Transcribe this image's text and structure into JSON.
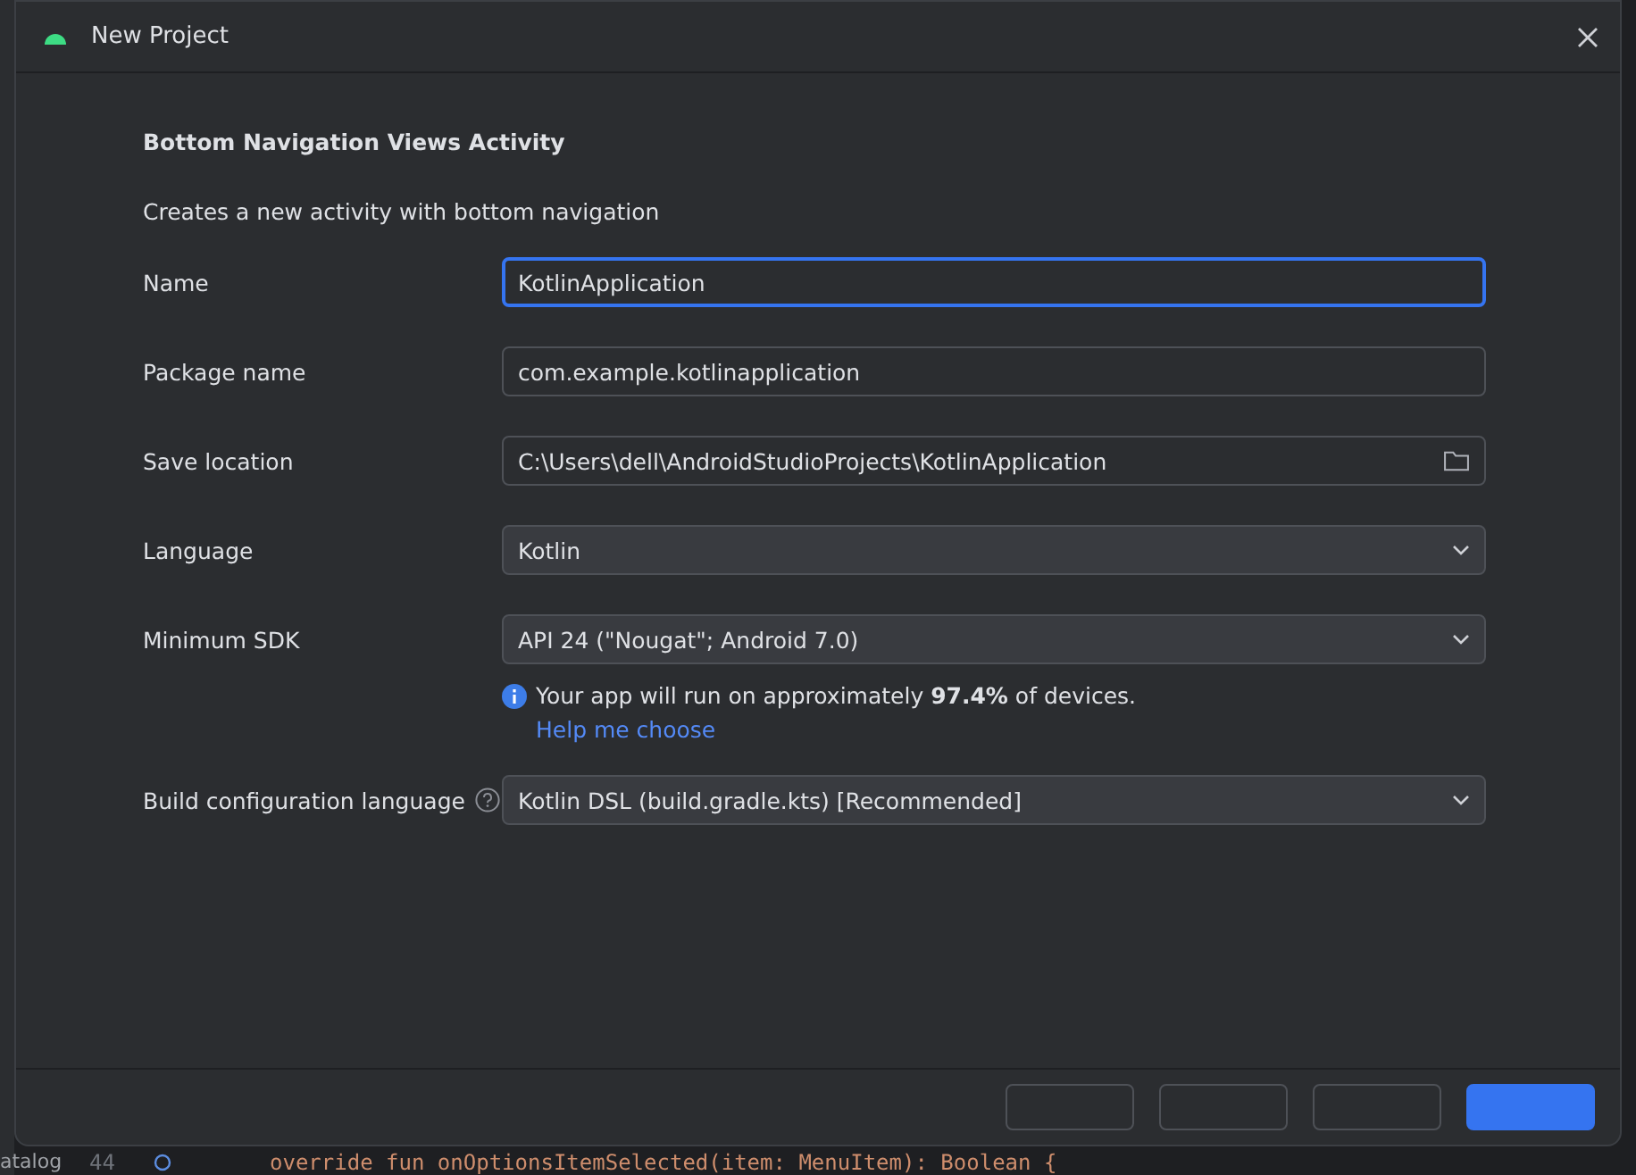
{
  "window": {
    "title": "New Project"
  },
  "heading": "Bottom Navigation Views Activity",
  "description": "Creates a new activity with bottom navigation",
  "fields": [
    {
      "label": "Name",
      "kind": "text",
      "value": "KotlinApplication",
      "focused": true
    },
    {
      "label": "Package name",
      "kind": "text",
      "value": "com.example.kotlinapplication",
      "focused": false
    },
    {
      "label": "Save location",
      "kind": "folder",
      "value": "C:\\Users\\dell\\AndroidStudioProjects\\KotlinApplication",
      "focused": false
    },
    {
      "label": "Language",
      "kind": "dropdown",
      "value": "Kotlin",
      "focused": false
    },
    {
      "label": "Minimum SDK",
      "kind": "dropdown",
      "value": "API 24 (\"Nougat\"; Android 7.0)",
      "focused": false
    }
  ],
  "sdk_info": {
    "text": "Your app will run on approximately **97.4%** of devices.",
    "link": "Help me choose"
  },
  "build_config": {
    "label": "Build configuration language",
    "value": "Kotlin DSL (build.gradle.kts) [Recommended]"
  },
  "footer_buttons": [
    {
      "primary": false
    },
    {
      "primary": false
    },
    {
      "primary": false
    },
    {
      "primary": true
    }
  ],
  "background_editor": {
    "sidebar_text": "atalog",
    "line_number": "44",
    "code": "override fun onOptionsItemSelected(item: MenuItem): Boolean {"
  }
}
